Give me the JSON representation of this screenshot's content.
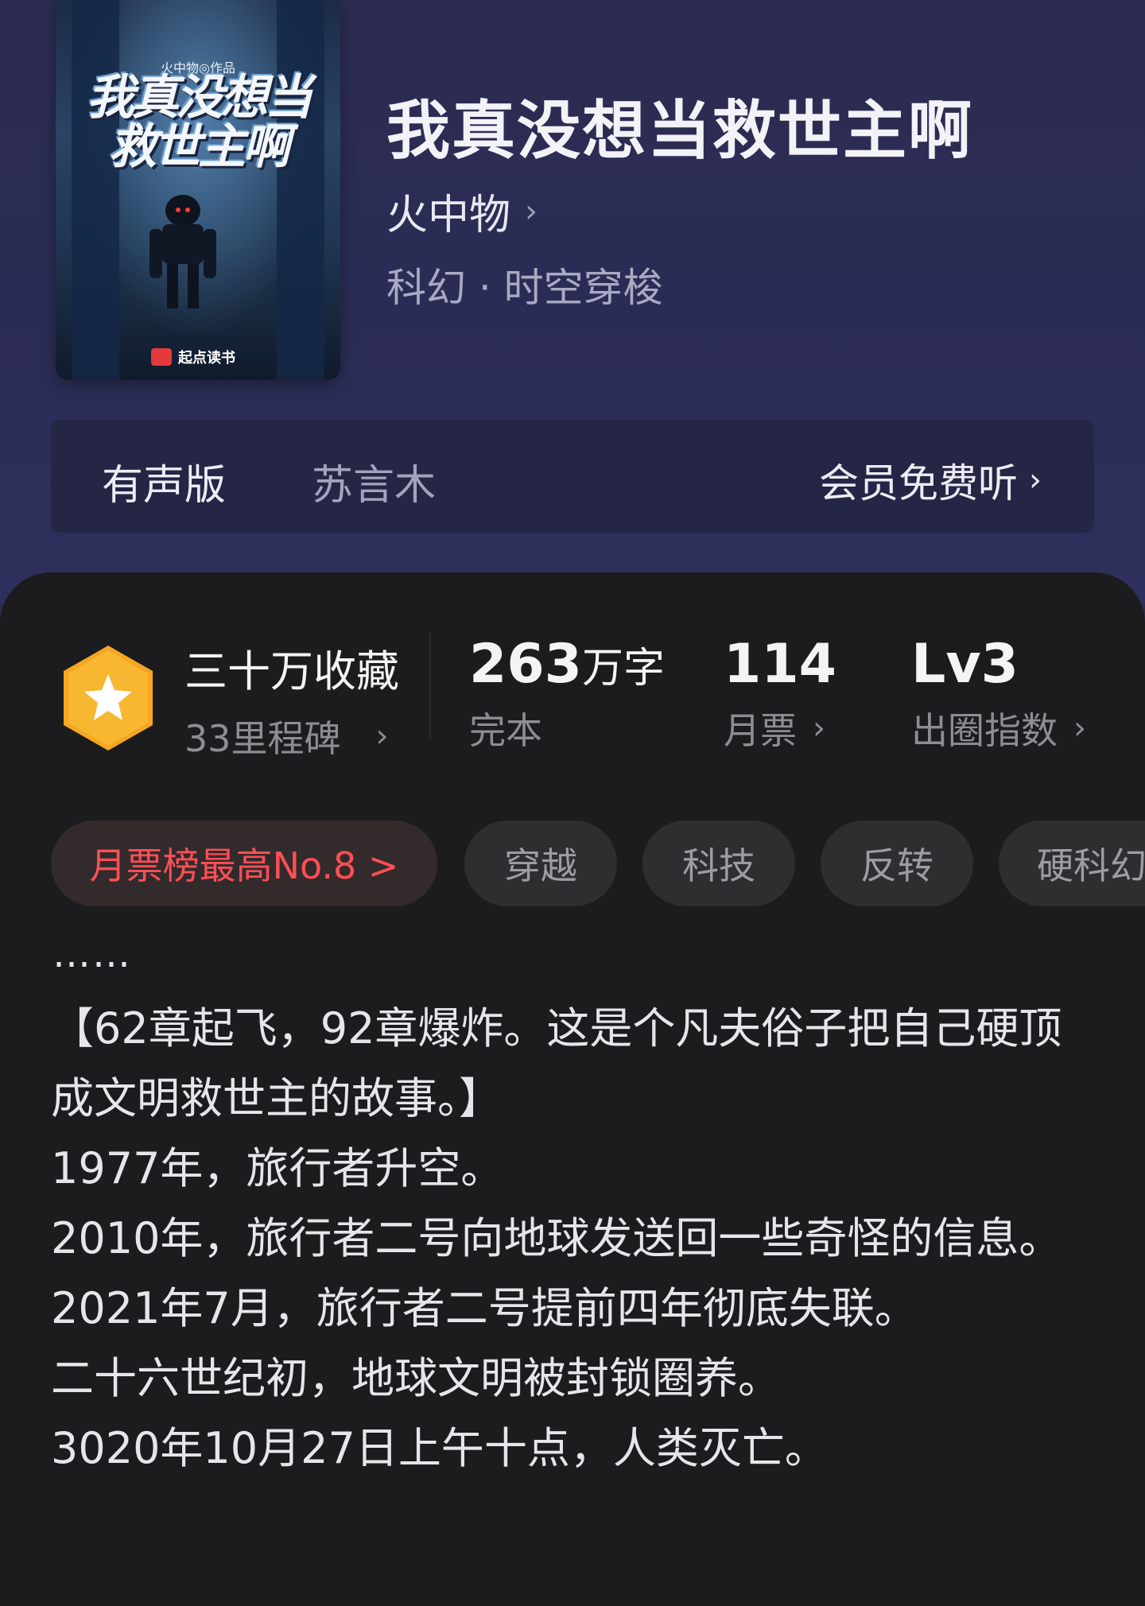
{
  "book": {
    "title": "我真没想当救世主啊",
    "author": "火中物",
    "genre": "科幻 · 时空穿梭",
    "cover": {
      "author_tag": "火中物◎作品",
      "title_line1": "我真没想当",
      "title_line2": "救世主啊",
      "publisher": "起点读书"
    }
  },
  "audio": {
    "label": "有声版",
    "narrator": "苏言木",
    "vip_link": "会员免费听"
  },
  "stats": {
    "favorites": {
      "title": "三十万收藏",
      "subtitle": "33里程碑"
    },
    "words": {
      "number": "263",
      "unit": "万字",
      "status": "完本"
    },
    "monthly_ticket": {
      "value": "114",
      "label": "月票"
    },
    "circle_index": {
      "value": "Lv3",
      "label": "出圈指数"
    }
  },
  "tags": [
    "月票榜最高No.8 >",
    "穿越",
    "科技",
    "反转",
    "硬科幻"
  ],
  "description": {
    "ellipsis": "……",
    "lines": [
      "【62章起飞，92章爆炸。这是个凡夫俗子把自己硬顶成文明救世主的故事。】",
      "1977年，旅行者升空。",
      "2010年，旅行者二号向地球发送回一些奇怪的信息。",
      "2021年7月，旅行者二号提前四年彻底失联。",
      "二十六世纪初，地球文明被封锁圈养。",
      "3020年10月27日上午十点，人类灭亡。"
    ]
  },
  "colors": {
    "hero_bg": "#2c2c52",
    "panel_bg": "#1c1c1e",
    "accent_red": "#ff4e55",
    "badge_gold": "#f5a623"
  }
}
